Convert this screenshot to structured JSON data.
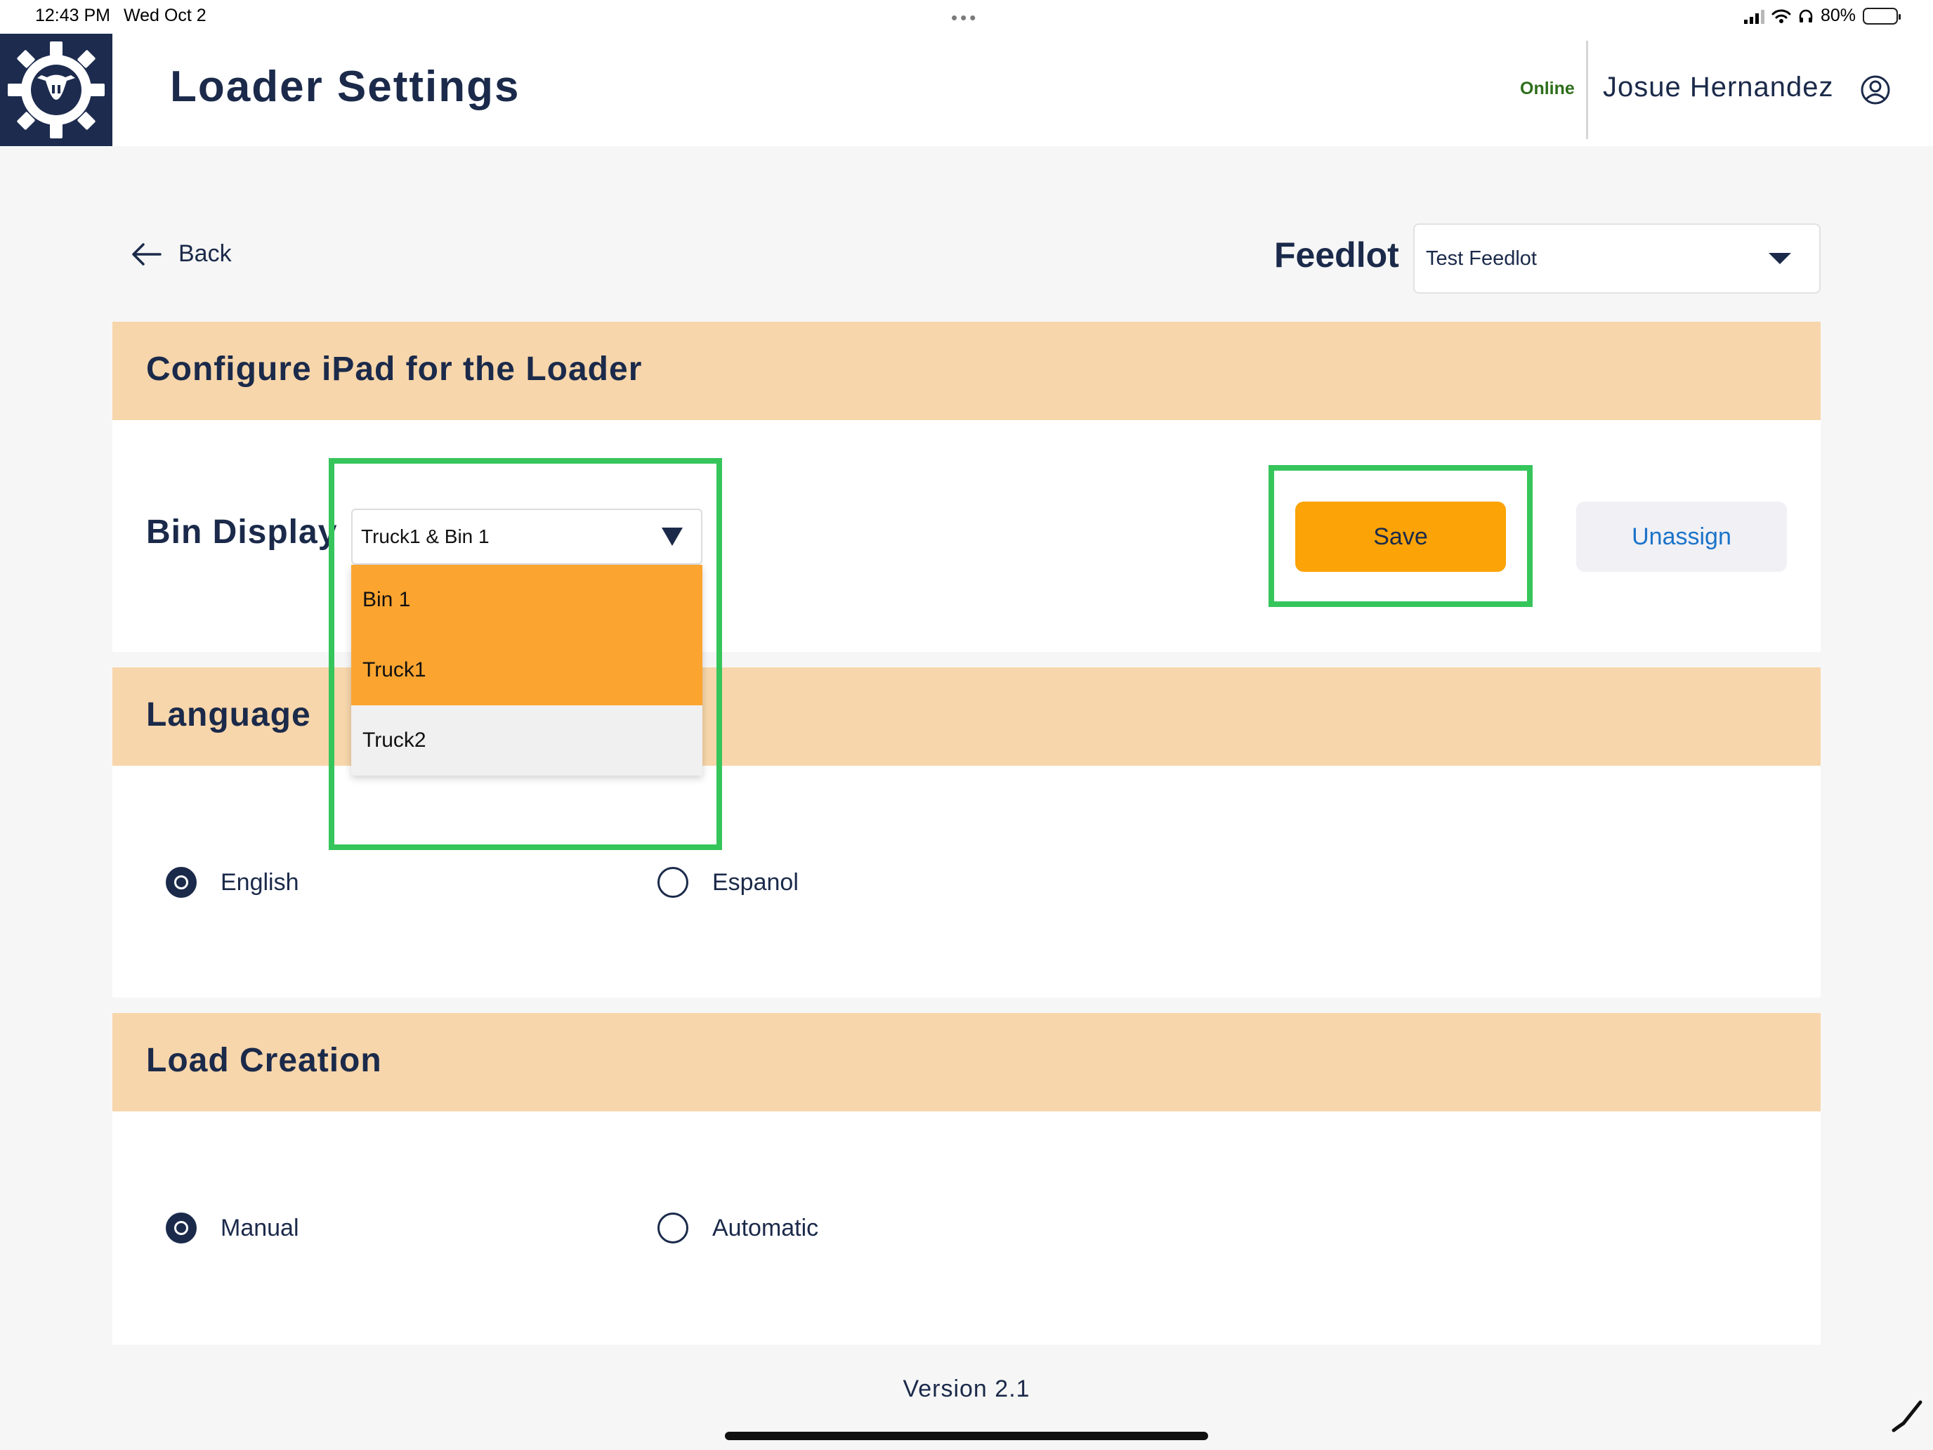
{
  "status_bar": {
    "time": "12:43 PM",
    "date": "Wed Oct 2",
    "battery": "80%",
    "battery_level": 0.8
  },
  "header": {
    "title": "Loader Settings",
    "connection_status": "Online",
    "user_name": "Josue Hernandez",
    "logo_icon": "gear-cow-logo-icon",
    "profile_icon": "user-circle-icon"
  },
  "nav": {
    "back_label": "Back",
    "back_icon": "arrow-left-icon"
  },
  "feedlot": {
    "label": "Feedlot",
    "selected": "Test Feedlot"
  },
  "configure": {
    "section_title": "Configure iPad for the Loader",
    "bin_display_label": "Bin Display",
    "bin_display_selected": "Truck1 & Bin 1",
    "dropdown_options": [
      {
        "label": "Bin 1",
        "selected": true
      },
      {
        "label": "Truck1",
        "selected": true
      },
      {
        "label": "Truck2",
        "selected": false
      }
    ],
    "save_label": "Save",
    "unassign_label": "Unassign"
  },
  "language": {
    "section_title": "Language",
    "options": [
      {
        "label": "English",
        "selected": true
      },
      {
        "label": "Espanol",
        "selected": false
      }
    ]
  },
  "load_creation": {
    "section_title": "Load Creation",
    "options": [
      {
        "label": "Manual",
        "selected": true
      },
      {
        "label": "Automatic",
        "selected": false
      }
    ]
  },
  "footer": {
    "version": "Version 2.1"
  },
  "colors": {
    "navy": "#1b2a4a",
    "band": "#f7d6ab",
    "accent_orange": "#fba307",
    "highlight_green": "#36c55b",
    "link_blue": "#1a73c9"
  }
}
